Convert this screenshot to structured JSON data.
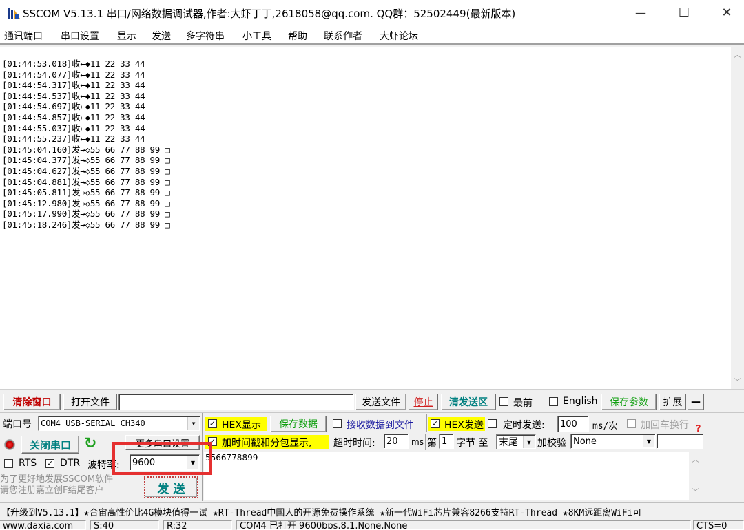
{
  "window": {
    "title": "SSCOM V5.13.1 串口/网络数据调试器,作者:大虾丁丁,2618058@qq.com. QQ群：52502449(最新版本)",
    "minimize_glyph": "—",
    "maximize_glyph": "☐",
    "close_glyph": "✕"
  },
  "menu": [
    "通讯端口",
    "串口设置",
    "显示",
    "发送",
    "多字符串",
    "小工具",
    "帮助",
    "联系作者",
    "大虾论坛"
  ],
  "receive_log": [
    {
      "time": "[01:44:53.018]",
      "dir": "收←◆",
      "data": "11 22 33 44"
    },
    {
      "time": "[01:44:54.077]",
      "dir": "收←◆",
      "data": "11 22 33 44"
    },
    {
      "time": "[01:44:54.317]",
      "dir": "收←◆",
      "data": "11 22 33 44"
    },
    {
      "time": "[01:44:54.537]",
      "dir": "收←◆",
      "data": "11 22 33 44"
    },
    {
      "time": "[01:44:54.697]",
      "dir": "收←◆",
      "data": "11 22 33 44"
    },
    {
      "time": "[01:44:54.857]",
      "dir": "收←◆",
      "data": "11 22 33 44"
    },
    {
      "time": "[01:44:55.037]",
      "dir": "收←◆",
      "data": "11 22 33 44"
    },
    {
      "time": "[01:44:55.237]",
      "dir": "收←◆",
      "data": "11 22 33 44"
    },
    {
      "time": "[01:45:04.160]",
      "dir": "发→◇",
      "data": "55 66 77 88 99 □"
    },
    {
      "time": "[01:45:04.377]",
      "dir": "发→◇",
      "data": "55 66 77 88 99 □"
    },
    {
      "time": "[01:45:04.627]",
      "dir": "发→◇",
      "data": "55 66 77 88 99 □"
    },
    {
      "time": "[01:45:04.881]",
      "dir": "发→◇",
      "data": "55 66 77 88 99 □"
    },
    {
      "time": "[01:45:05.811]",
      "dir": "发→◇",
      "data": "55 66 77 88 99 □"
    },
    {
      "time": "[01:45:12.980]",
      "dir": "发→◇",
      "data": "55 66 77 88 99 □"
    },
    {
      "time": "[01:45:17.990]",
      "dir": "发→◇",
      "data": "55 66 77 88 99 □"
    },
    {
      "time": "[01:45:18.246]",
      "dir": "发→◇",
      "data": "55 66 77 88 99 □"
    }
  ],
  "toolbar": {
    "clear_window": "清除窗口",
    "open_file": "打开文件",
    "file_path": "",
    "send_file": "发送文件",
    "stop": "停止",
    "clear_send": "清发送区",
    "topmost_label": "最前",
    "topmost_checked": false,
    "english_label": "English",
    "english_checked": false,
    "save_params": "保存参数",
    "expand": "扩展",
    "collapse": "—"
  },
  "port": {
    "port_label": "端口号",
    "port_value": "COM4 USB-SERIAL CH340",
    "close_port": "关闭串口",
    "more_settings": "更多串口设置",
    "rts_label": "RTS",
    "rts_checked": false,
    "dtr_label": "DTR",
    "dtr_checked": true,
    "baud_label": "波特率:",
    "baud_value": "9600",
    "promo_line1": "为了更好地发展SSCOM软件",
    "promo_line2": "请您注册嘉立创F结尾客户",
    "send": "发  送"
  },
  "options": {
    "hex_display_label": "HEX显示",
    "hex_display_checked": true,
    "save_data": "保存数据",
    "recv_to_file_label": "接收数据到文件",
    "recv_to_file_checked": false,
    "hex_send_label": "HEX发送",
    "hex_send_checked": true,
    "timed_send_label": "定时发送:",
    "timed_send_checked": false,
    "timed_interval": "100",
    "interval_unit": "ms/次",
    "add_crlf_label": "加回车换行",
    "add_crlf_checked": false,
    "help_glyph": "?",
    "timestamp_label": "加时间戳和分包显示,",
    "timestamp_checked": true,
    "timeout_label": "超时时间:",
    "timeout_value": "20",
    "timeout_unit": "ms",
    "byte_from_label": "第",
    "byte_from_value": "1",
    "byte_unit": "字节 至",
    "byte_to_value": "末尾",
    "checksum_label": "加校验",
    "checksum_value": "None",
    "extra_value": ""
  },
  "send_text": "5566778899",
  "marquee": "【升级到V5.13.1】★合宙高性价比4G模块值得一试 ★RT-Thread中国人的开源免费操作系统 ★新一代WiFi芯片兼容8266支持RT-Thread ★8KM远距离WiFi可",
  "status": {
    "website": "www.daxia.com",
    "sent": "S:40",
    "received": "R:32",
    "port_status": "COM4 已打开  9600bps,8,1,None,None",
    "cts": "CTS=0"
  }
}
